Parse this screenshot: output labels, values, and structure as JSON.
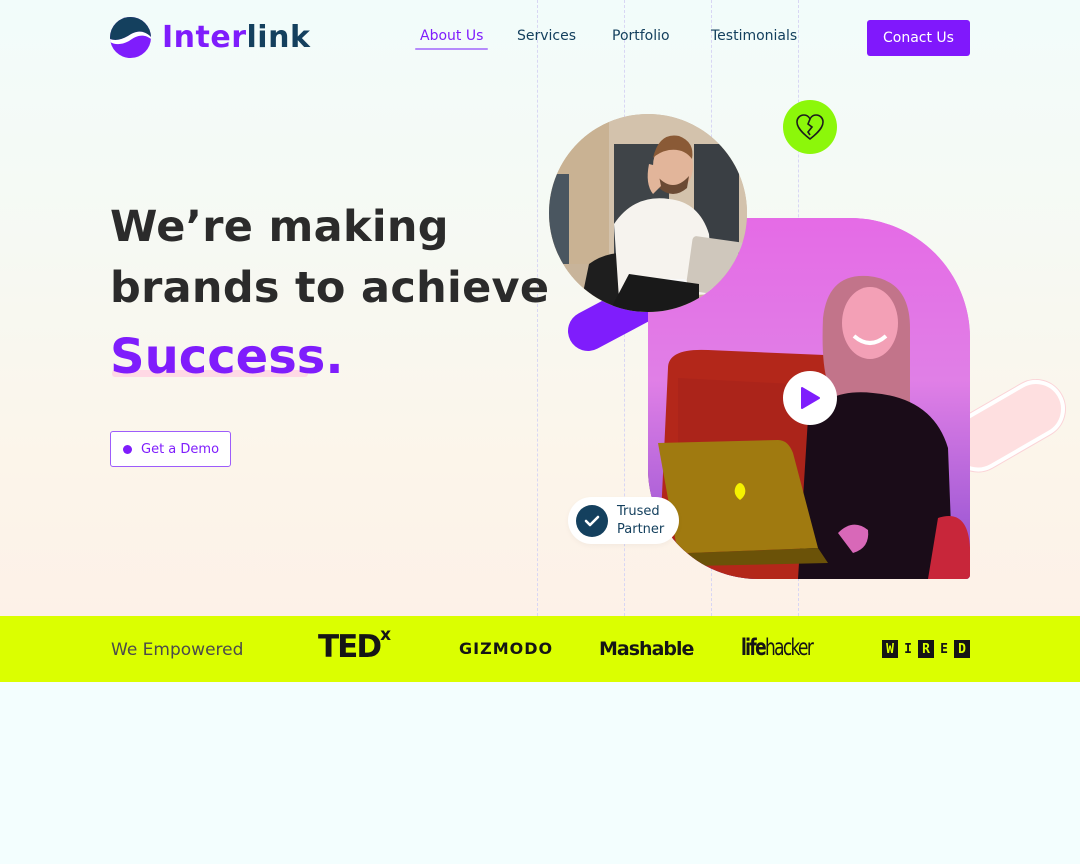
{
  "header": {
    "logo": {
      "part1": "Inter",
      "part2": "link"
    },
    "nav": [
      {
        "label": "About Us",
        "active": true
      },
      {
        "label": "Services",
        "active": false
      },
      {
        "label": "Portfolio",
        "active": false
      },
      {
        "label": "Testimonials",
        "active": false
      }
    ],
    "cta_label": "Conact Us"
  },
  "hero": {
    "headline_line1": "We’re making",
    "headline_line2": "brands to achieve",
    "headline_accent": "Success.",
    "demo_button": "Get a Demo",
    "badge": {
      "line1": "Trused",
      "line2": "Partner",
      "icon": "check-icon"
    },
    "floating_icon": "broken-heart-icon",
    "play_icon": "play-icon"
  },
  "brands": {
    "label": "We Empowered",
    "logos": [
      {
        "name": "TEDx",
        "main": "TED",
        "sup": "x"
      },
      {
        "name": "GIZMODO"
      },
      {
        "name": "Mashable"
      },
      {
        "name": "lifehacker",
        "bold": "life",
        "rest": "hacker"
      },
      {
        "name": "WIRED",
        "letters": [
          "W",
          "I",
          "R",
          "E",
          "D"
        ]
      }
    ]
  },
  "colors": {
    "primary": "#7f1dfc",
    "navy": "#14405e",
    "lime": "#dbff00",
    "green_badge": "#8cf70a",
    "pink": "#fedfe0"
  }
}
